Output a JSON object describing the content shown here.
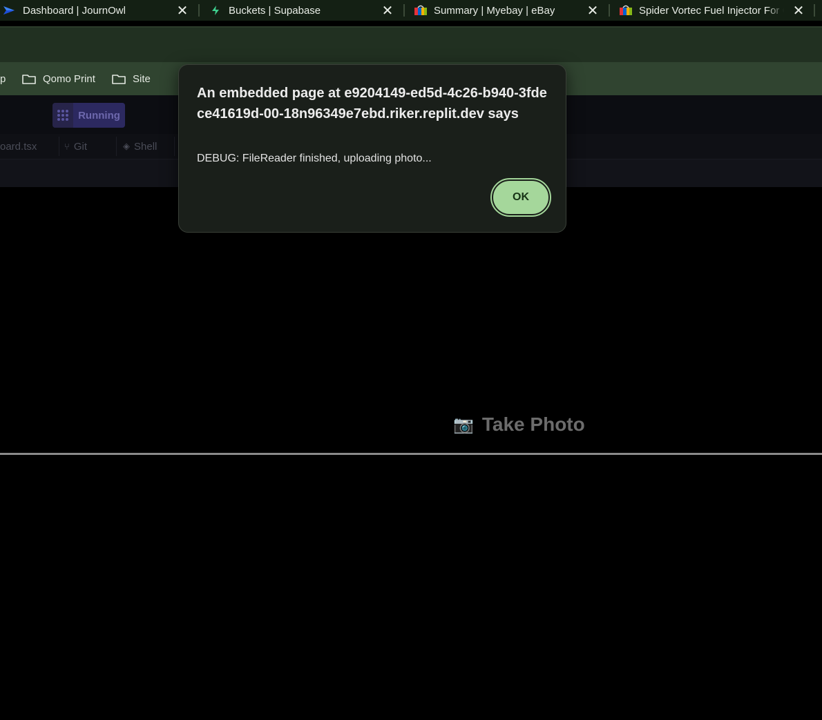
{
  "browser": {
    "tabs": [
      {
        "title": "Dashboard | JournOwl",
        "icon": "journowl-logo-icon"
      },
      {
        "title": "Buckets | Supabase",
        "icon": "supabase-bolt-icon"
      },
      {
        "title": "Summary | Myebay | eBay",
        "icon": "ebay-bag-icon"
      },
      {
        "title": "Spider Vortec Fuel Injector For C",
        "icon": "ebay-bag-icon"
      }
    ],
    "close_glyph": "✕",
    "bookmarks": [
      {
        "label": "p"
      },
      {
        "label": "Qomo Print"
      },
      {
        "label": "Site"
      }
    ]
  },
  "app": {
    "run_label": "Running",
    "file_tabs": [
      {
        "label": "oard.tsx"
      },
      {
        "label": "Git"
      },
      {
        "label": "Shell"
      }
    ],
    "take_photo_label": "Take Photo",
    "camera_icon": "📷"
  },
  "dialog": {
    "heading": "An embedded page at e9204149-ed5d-4c26-b940-3fdece41619d-00-18n96349e7ebd.riker.replit.dev says",
    "message": "DEBUG: FileReader finished, uploading photo...",
    "ok_label": "OK"
  },
  "colors": {
    "tabstrip": "#142014",
    "toolbar": "#213021",
    "bookmarks_bar": "#304430",
    "dialog_bg": "#1a1f1a",
    "ok_button": "#a5d79b",
    "running_pill": "#2c2960"
  }
}
